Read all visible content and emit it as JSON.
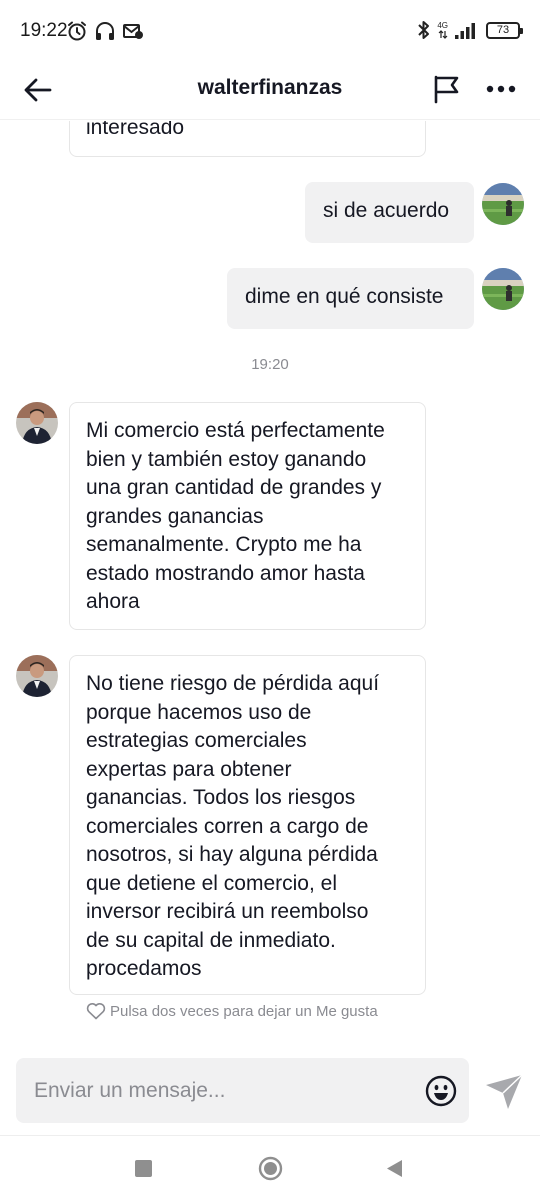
{
  "status_bar": {
    "time": "19:22",
    "network": "4G",
    "battery": "73",
    "icons": [
      "alarm-icon",
      "headphones-icon",
      "message-icon",
      "bluetooth-icon",
      "signal-icon",
      "battery-icon"
    ]
  },
  "header": {
    "title": "walterfinanzas",
    "icons": [
      "back-arrow-icon",
      "flag-icon",
      "more-icon"
    ]
  },
  "messages": {
    "m0": {
      "from": "other",
      "text": "interesado"
    },
    "m1": {
      "from": "me",
      "text": "si de acuerdo"
    },
    "m2": {
      "from": "me",
      "text": "dime en qué consiste"
    },
    "timestamp": "19:20",
    "m3": {
      "from": "other",
      "lines": [
        "Mi comercio está perfectamente",
        "bien y también estoy ganando",
        "una gran cantidad de grandes y",
        "grandes ganancias",
        "semanalmente. Crypto me ha",
        "estado mostrando amor hasta",
        "ahora"
      ]
    },
    "m4": {
      "from": "other",
      "lines": [
        "No tiene riesgo de pérdida aquí",
        "porque hacemos uso de",
        "estrategias comerciales",
        "expertas para obtener",
        "ganancias. Todos los riesgos",
        "comerciales corren a cargo de",
        "nosotros, si hay alguna pérdida",
        "que detiene el comercio, el",
        "inversor recibirá un reembolso",
        "de su capital de inmediato.",
        "procedamos"
      ]
    },
    "like_hint": "Pulsa dos veces para dejar un Me gusta"
  },
  "composer": {
    "placeholder": "Enviar un mensaje...",
    "icons": [
      "emoji-icon",
      "send-icon"
    ]
  },
  "nav": {
    "icons": [
      "recent-apps-icon",
      "home-icon",
      "back-icon"
    ]
  },
  "colors": {
    "text": "#161823",
    "muted": "#8a8b91",
    "bubble_out": "#f1f1f2",
    "bubble_in_border": "#e6e6e6"
  }
}
